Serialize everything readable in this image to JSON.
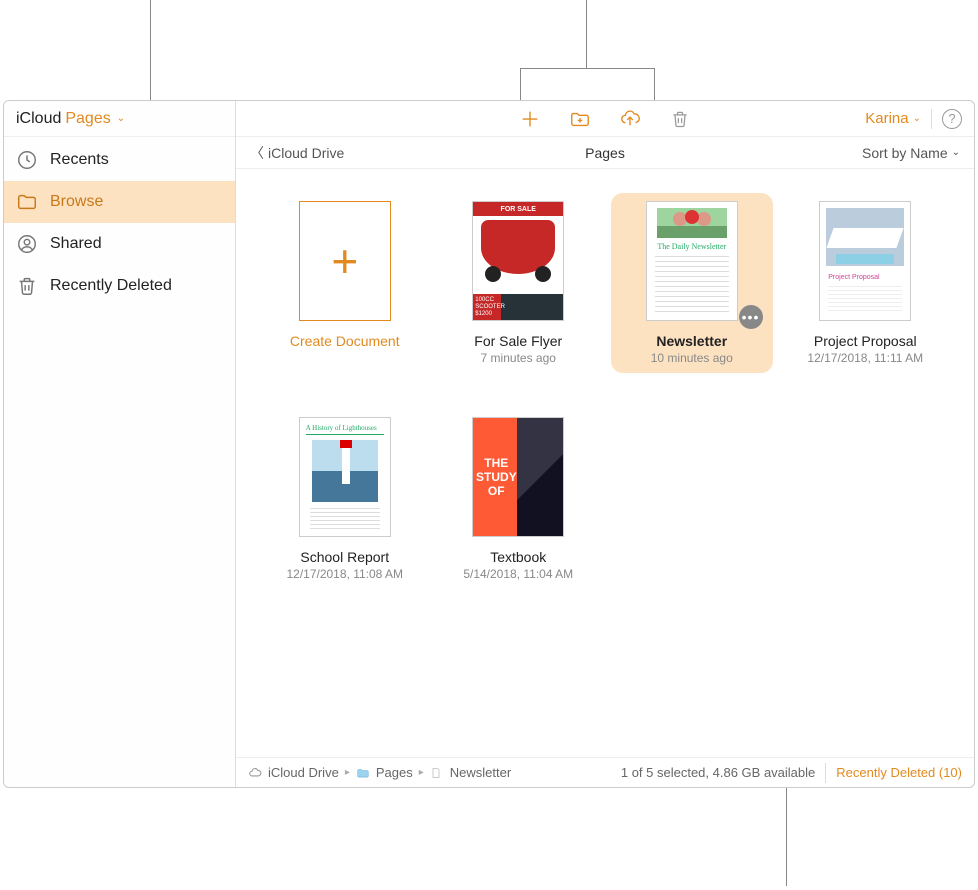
{
  "colors": {
    "accent": "#e28a1f",
    "selection": "#fde2c2"
  },
  "header": {
    "icloud": "iCloud",
    "app_name": "Pages",
    "account_name": "Karina"
  },
  "sidebar": {
    "items": [
      {
        "id": "recents",
        "label": "Recents",
        "active": false
      },
      {
        "id": "browse",
        "label": "Browse",
        "active": true
      },
      {
        "id": "shared",
        "label": "Shared",
        "active": false
      },
      {
        "id": "recently-deleted",
        "label": "Recently Deleted",
        "active": false
      }
    ]
  },
  "toolbar": {
    "icons": {
      "add": "plus-icon",
      "new_folder": "new-folder-icon",
      "upload": "cloud-upload-icon",
      "delete": "trash-icon",
      "help": "help-icon"
    }
  },
  "subheader": {
    "back_label": "iCloud Drive",
    "title": "Pages",
    "sort_label": "Sort by Name"
  },
  "documents": [
    {
      "id": "create",
      "title": "Create Document",
      "meta": "",
      "kind": "create",
      "selected": false
    },
    {
      "id": "for-sale-flyer",
      "title": "For Sale Flyer",
      "meta": "7 minutes ago",
      "kind": "forsale",
      "selected": false,
      "thumb_text": {
        "banner": "FOR SALE",
        "price_lines": "100CC\nSCOOTER\n$1200"
      }
    },
    {
      "id": "newsletter",
      "title": "Newsletter",
      "meta": "10 minutes ago",
      "kind": "newsletter",
      "selected": true,
      "thumb_text": {
        "heading": "The Daily Newsletter"
      }
    },
    {
      "id": "project-proposal",
      "title": "Project Proposal",
      "meta": "12/17/2018, 11:11 AM",
      "kind": "proposal",
      "selected": false,
      "thumb_text": {
        "label": "Project Proposal"
      }
    },
    {
      "id": "school-report",
      "title": "School Report",
      "meta": "12/17/2018, 11:08 AM",
      "kind": "lighthouse",
      "selected": false,
      "thumb_text": {
        "heading": "A History of Lighthouses"
      }
    },
    {
      "id": "textbook",
      "title": "Textbook",
      "meta": "5/14/2018, 11:04 AM",
      "kind": "textbook",
      "selected": false,
      "thumb_text": {
        "cover": "THE STUDY OF"
      }
    }
  ],
  "statusbar": {
    "crumbs": [
      "iCloud Drive",
      "Pages",
      "Newsletter"
    ],
    "selection_text": "1 of 5 selected, 4.86 GB available",
    "recently_deleted_label": "Recently Deleted (10)"
  }
}
